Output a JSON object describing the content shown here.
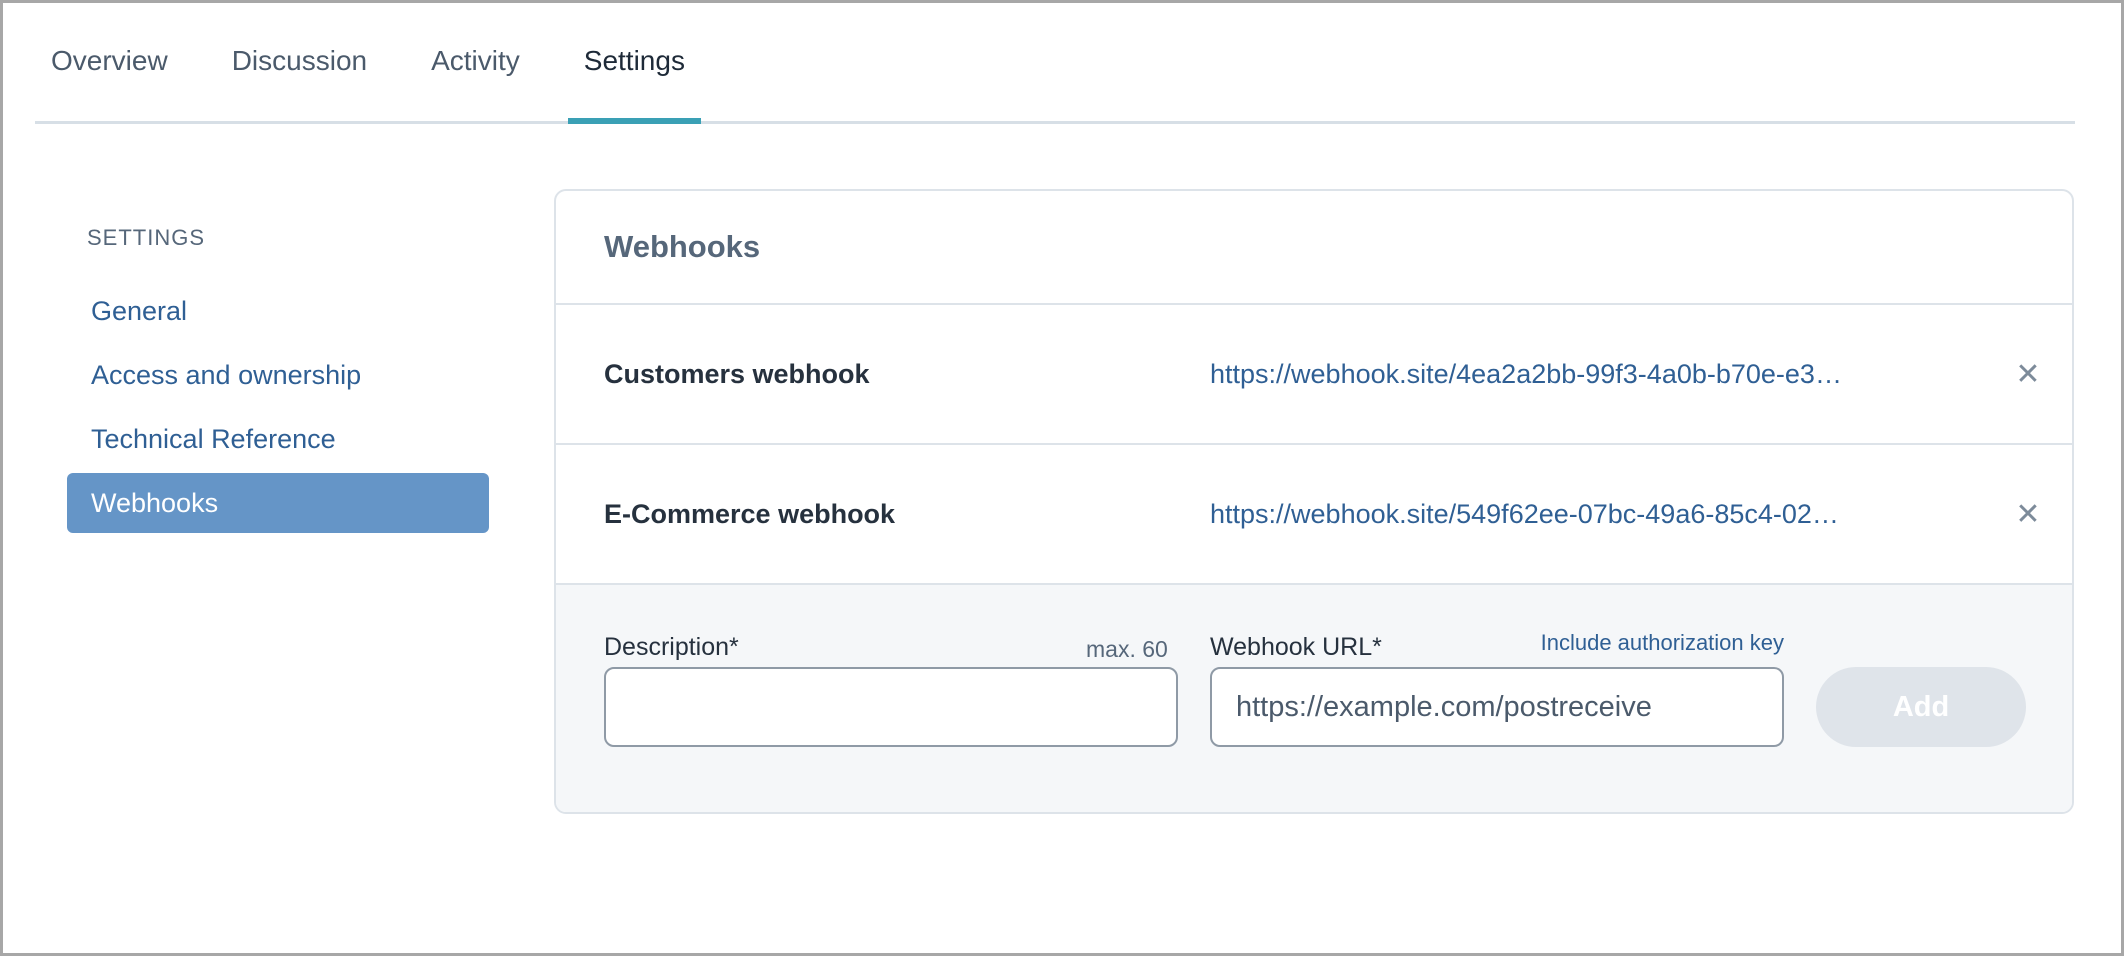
{
  "tabs": [
    {
      "label": "Overview",
      "active": false
    },
    {
      "label": "Discussion",
      "active": false
    },
    {
      "label": "Activity",
      "active": false
    },
    {
      "label": "Settings",
      "active": true
    }
  ],
  "sidebar": {
    "heading": "SETTINGS",
    "items": [
      {
        "label": "General",
        "active": false
      },
      {
        "label": "Access and ownership",
        "active": false
      },
      {
        "label": "Technical Reference",
        "active": false
      },
      {
        "label": "Webhooks",
        "active": true
      }
    ]
  },
  "panel": {
    "title": "Webhooks",
    "webhooks": [
      {
        "name": "Customers webhook",
        "url": "https://webhook.site/4ea2a2bb-99f3-4a0b-b70e-e3…",
        "remove_icon": "close-icon"
      },
      {
        "name": "E-Commerce webhook",
        "url": "https://webhook.site/549f62ee-07bc-49a6-85c4-02…",
        "remove_icon": "close-icon"
      }
    ],
    "form": {
      "description_label": "Description*",
      "description_hint": "max. 60",
      "description_value": "",
      "url_label": "Webhook URL*",
      "url_link": "Include authorization key",
      "url_placeholder": "https://example.com/postreceive",
      "add_label": "Add"
    }
  },
  "colors": {
    "accent_tab": "#3aa0b5",
    "sidebar_active_bg": "#6595c7",
    "link": "#2f5f94",
    "add_button_disabled": "#dfe4ea"
  }
}
